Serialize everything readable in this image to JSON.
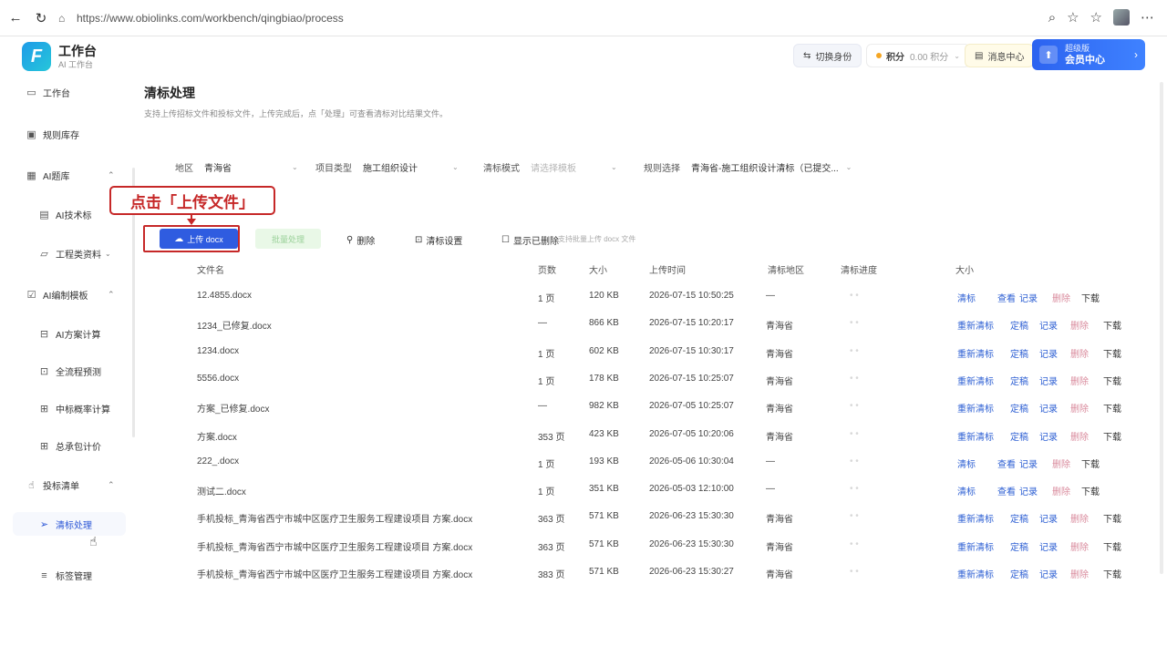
{
  "browser": {
    "url": "https://www.obiolinks.com/workbench/qingbiao/process"
  },
  "header": {
    "brand_title": "工作台",
    "brand_sub": "AI 工作台",
    "switch_label": "切换身份",
    "points_label": "积分",
    "points_value": "0.00 积分",
    "message_label": "消息中心",
    "vip_line1": "超级版",
    "vip_line2": "会员中心"
  },
  "sidebar": {
    "items": [
      {
        "label": "工作台",
        "icon": "monitor-icon"
      },
      {
        "label": "规则库存",
        "icon": "doc-icon"
      },
      {
        "label": "AI题库",
        "icon": "grid-icon"
      },
      {
        "label": "AI技术标",
        "icon": "file-icon"
      },
      {
        "label": "工程类资料",
        "icon": "folder-icon"
      },
      {
        "label": "AI编制模板",
        "icon": "check-icon"
      },
      {
        "label": "AI方案计算",
        "icon": "calc-icon"
      },
      {
        "label": "全流程预测",
        "icon": "chart-icon"
      },
      {
        "label": "中标概率计算",
        "icon": "table-icon"
      },
      {
        "label": "总承包计价",
        "icon": "table-icon"
      },
      {
        "label": "投标清单",
        "icon": "hand-icon"
      },
      {
        "label": "清标处理",
        "icon": "send-icon"
      },
      {
        "label": "标签管理",
        "icon": "list-icon"
      }
    ]
  },
  "page": {
    "title": "清标处理",
    "description": "支持上传招标文件和投标文件，上传完成后，点「处理」可查看清标对比结果文件。"
  },
  "filters": {
    "region_label": "地区",
    "region_value": "青海省",
    "project_label": "项目类型",
    "project_value": "施工组织设计",
    "template_label": "清标模式",
    "template_value": "请选择模板",
    "rule_label": "规则选择",
    "rule_value": "青海省-施工组织设计清标（已提交..."
  },
  "toolbar": {
    "upload_label": "上传 docx",
    "green_label": "批量处理",
    "delete_label": "删除",
    "settings_label": "清标设置",
    "hint_label": "显示已删除",
    "hint_text": "支持批量上传 docx 文件"
  },
  "table": {
    "headers": [
      "文件名",
      "页数",
      "大小",
      "上传时间",
      "清标地区",
      "清标进度",
      "大小"
    ],
    "rows": [
      {
        "name": "12.4855.docx",
        "pages": "1 页",
        "size": "120 KB",
        "time": "2026-07-15 10:50:25",
        "region": "—",
        "actions": [
          "清标",
          "查看",
          "记录",
          "删除",
          "下载"
        ]
      },
      {
        "name": "1234_已修复.docx",
        "pages": "—",
        "size": "866 KB",
        "time": "2026-07-15 10:20:17",
        "region": "青海省",
        "actions": [
          "重新清标",
          "定稿",
          "记录",
          "删除",
          "下载"
        ]
      },
      {
        "name": "1234.docx",
        "pages": "1 页",
        "size": "602 KB",
        "time": "2026-07-15 10:30:17",
        "region": "青海省",
        "actions": [
          "重新清标",
          "定稿",
          "记录",
          "删除",
          "下载"
        ]
      },
      {
        "name": "5556.docx",
        "pages": "1 页",
        "size": "178 KB",
        "time": "2026-07-15 10:25:07",
        "region": "青海省",
        "actions": [
          "重新清标",
          "定稿",
          "记录",
          "删除",
          "下载"
        ]
      },
      {
        "name": "方案_已修复.docx",
        "pages": "—",
        "size": "982 KB",
        "time": "2026-07-05 10:25:07",
        "region": "青海省",
        "actions": [
          "重新清标",
          "定稿",
          "记录",
          "删除",
          "下载"
        ]
      },
      {
        "name": "方案.docx",
        "pages": "353 页",
        "size": "423 KB",
        "time": "2026-07-05 10:20:06",
        "region": "青海省",
        "actions": [
          "重新清标",
          "定稿",
          "记录",
          "删除",
          "下载"
        ]
      },
      {
        "name": "222_.docx",
        "pages": "1 页",
        "size": "193 KB",
        "time": "2026-05-06 10:30:04",
        "region": "—",
        "actions": [
          "清标",
          "查看",
          "记录",
          "删除",
          "下载"
        ]
      },
      {
        "name": "测试二.docx",
        "pages": "1 页",
        "size": "351 KB",
        "time": "2026-05-03 12:10:00",
        "region": "—",
        "actions": [
          "清标",
          "查看",
          "记录",
          "删除",
          "下载"
        ]
      },
      {
        "name": "手机投标_青海省西宁市城中区医疗卫生服务工程建设项目 方案.docx",
        "pages": "363 页",
        "size": "571 KB",
        "time": "2026-06-23 15:30:30",
        "region": "青海省",
        "actions": [
          "重新清标",
          "定稿",
          "记录",
          "删除",
          "下载"
        ]
      },
      {
        "name": "手机投标_青海省西宁市城中区医疗卫生服务工程建设项目 方案.docx",
        "pages": "363 页",
        "size": "571 KB",
        "time": "2026-06-23 15:30:30",
        "region": "青海省",
        "actions": [
          "重新清标",
          "定稿",
          "记录",
          "删除",
          "下载"
        ]
      },
      {
        "name": "手机投标_青海省西宁市城中区医疗卫生服务工程建设项目 方案.docx",
        "pages": "383 页",
        "size": "571 KB",
        "time": "2026-06-23 15:30:27",
        "region": "青海省",
        "actions": [
          "重新清标",
          "定稿",
          "记录",
          "删除",
          "下载"
        ]
      }
    ]
  },
  "callout": {
    "text": "点击「上传文件」"
  },
  "colors": {
    "accent": "#2f5ce0",
    "callout": "#c62828",
    "action_red": "#d98a9c"
  }
}
